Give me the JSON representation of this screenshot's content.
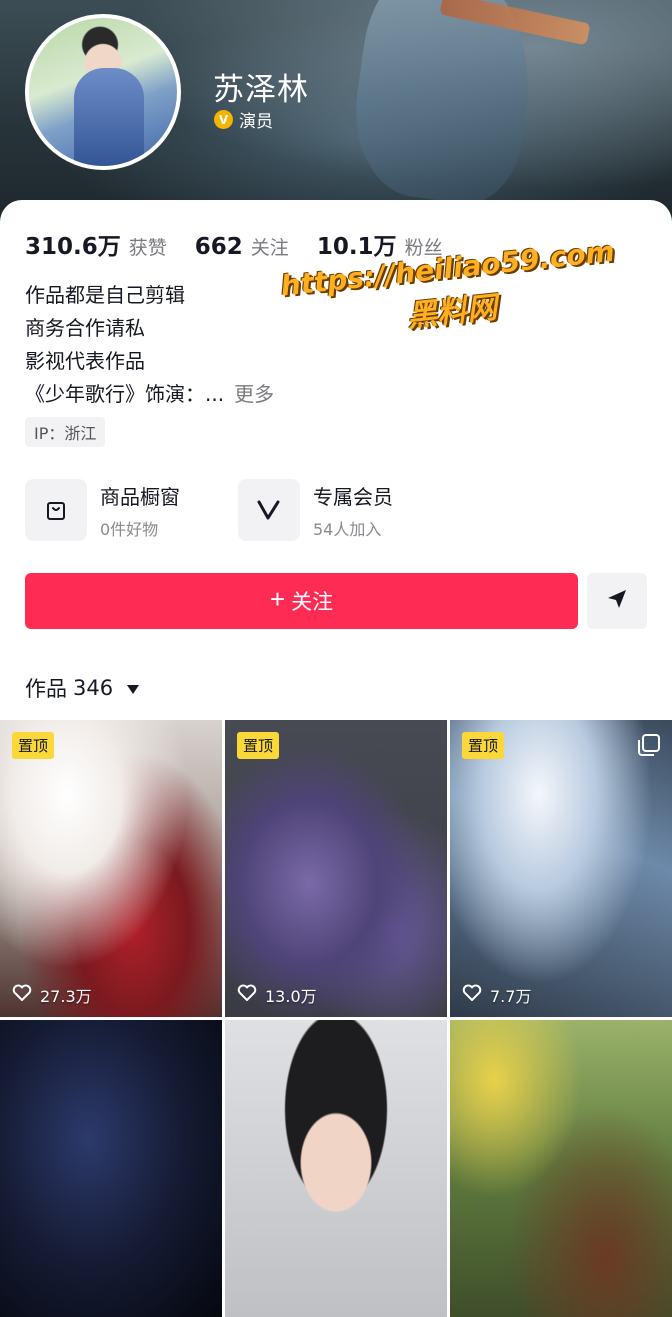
{
  "profile": {
    "name": "苏泽林",
    "badge_label": "演员",
    "badge_icon": "verified-v-icon",
    "badge_color": "#f5b400"
  },
  "stats": [
    {
      "value": "310.6万",
      "label": "获赞"
    },
    {
      "value": "662",
      "label": "关注"
    },
    {
      "value": "10.1万",
      "label": "粉丝"
    }
  ],
  "bio": {
    "lines": [
      "作品都是自己剪辑",
      "商务合作请私",
      "影视代表作品",
      "《少年歌行》饰演：..."
    ],
    "more": "更多"
  },
  "ip": "IP：浙江",
  "shortcuts": [
    {
      "title": "商品橱窗",
      "subtitle": "0件好物",
      "icon": "shopping-bag-icon"
    },
    {
      "title": "专属会员",
      "subtitle": "54人加入",
      "icon": "member-v-icon"
    }
  ],
  "actions": {
    "follow_label": "关注",
    "follow_color": "#fe2c55",
    "share_icon": "send-icon"
  },
  "works": {
    "label": "作品",
    "count": "346"
  },
  "videos": [
    {
      "pinned": true,
      "pin_label": "置顶",
      "likes": "27.3万"
    },
    {
      "pinned": true,
      "pin_label": "置顶",
      "likes": "13.0万"
    },
    {
      "pinned": true,
      "pin_label": "置顶",
      "likes": "7.7万",
      "multi": true
    },
    {
      "pinned": false,
      "likes": ""
    },
    {
      "pinned": false,
      "likes": ""
    },
    {
      "pinned": false,
      "likes": ""
    }
  ],
  "watermark": {
    "url": "https://heiliao59.com",
    "caption": "黑料网"
  }
}
